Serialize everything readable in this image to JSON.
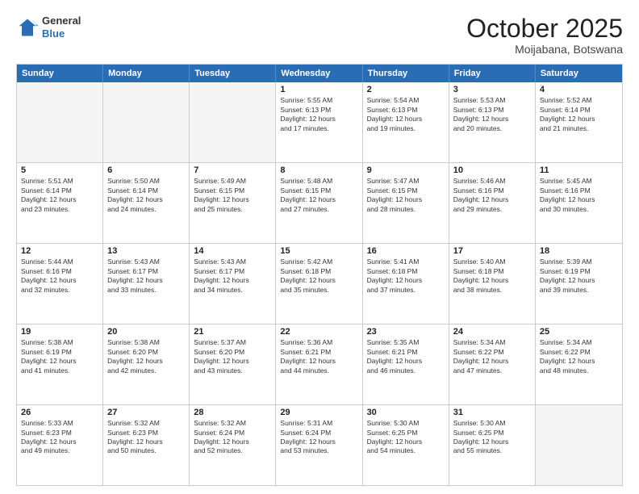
{
  "header": {
    "logo_general": "General",
    "logo_blue": "Blue",
    "month_title": "October 2025",
    "location": "Moijabana, Botswana"
  },
  "weekdays": [
    "Sunday",
    "Monday",
    "Tuesday",
    "Wednesday",
    "Thursday",
    "Friday",
    "Saturday"
  ],
  "rows": [
    [
      {
        "day": "",
        "info": ""
      },
      {
        "day": "",
        "info": ""
      },
      {
        "day": "",
        "info": ""
      },
      {
        "day": "1",
        "info": "Sunrise: 5:55 AM\nSunset: 6:13 PM\nDaylight: 12 hours\nand 17 minutes."
      },
      {
        "day": "2",
        "info": "Sunrise: 5:54 AM\nSunset: 6:13 PM\nDaylight: 12 hours\nand 19 minutes."
      },
      {
        "day": "3",
        "info": "Sunrise: 5:53 AM\nSunset: 6:13 PM\nDaylight: 12 hours\nand 20 minutes."
      },
      {
        "day": "4",
        "info": "Sunrise: 5:52 AM\nSunset: 6:14 PM\nDaylight: 12 hours\nand 21 minutes."
      }
    ],
    [
      {
        "day": "5",
        "info": "Sunrise: 5:51 AM\nSunset: 6:14 PM\nDaylight: 12 hours\nand 23 minutes."
      },
      {
        "day": "6",
        "info": "Sunrise: 5:50 AM\nSunset: 6:14 PM\nDaylight: 12 hours\nand 24 minutes."
      },
      {
        "day": "7",
        "info": "Sunrise: 5:49 AM\nSunset: 6:15 PM\nDaylight: 12 hours\nand 25 minutes."
      },
      {
        "day": "8",
        "info": "Sunrise: 5:48 AM\nSunset: 6:15 PM\nDaylight: 12 hours\nand 27 minutes."
      },
      {
        "day": "9",
        "info": "Sunrise: 5:47 AM\nSunset: 6:15 PM\nDaylight: 12 hours\nand 28 minutes."
      },
      {
        "day": "10",
        "info": "Sunrise: 5:46 AM\nSunset: 6:16 PM\nDaylight: 12 hours\nand 29 minutes."
      },
      {
        "day": "11",
        "info": "Sunrise: 5:45 AM\nSunset: 6:16 PM\nDaylight: 12 hours\nand 30 minutes."
      }
    ],
    [
      {
        "day": "12",
        "info": "Sunrise: 5:44 AM\nSunset: 6:16 PM\nDaylight: 12 hours\nand 32 minutes."
      },
      {
        "day": "13",
        "info": "Sunrise: 5:43 AM\nSunset: 6:17 PM\nDaylight: 12 hours\nand 33 minutes."
      },
      {
        "day": "14",
        "info": "Sunrise: 5:43 AM\nSunset: 6:17 PM\nDaylight: 12 hours\nand 34 minutes."
      },
      {
        "day": "15",
        "info": "Sunrise: 5:42 AM\nSunset: 6:18 PM\nDaylight: 12 hours\nand 35 minutes."
      },
      {
        "day": "16",
        "info": "Sunrise: 5:41 AM\nSunset: 6:18 PM\nDaylight: 12 hours\nand 37 minutes."
      },
      {
        "day": "17",
        "info": "Sunrise: 5:40 AM\nSunset: 6:18 PM\nDaylight: 12 hours\nand 38 minutes."
      },
      {
        "day": "18",
        "info": "Sunrise: 5:39 AM\nSunset: 6:19 PM\nDaylight: 12 hours\nand 39 minutes."
      }
    ],
    [
      {
        "day": "19",
        "info": "Sunrise: 5:38 AM\nSunset: 6:19 PM\nDaylight: 12 hours\nand 41 minutes."
      },
      {
        "day": "20",
        "info": "Sunrise: 5:38 AM\nSunset: 6:20 PM\nDaylight: 12 hours\nand 42 minutes."
      },
      {
        "day": "21",
        "info": "Sunrise: 5:37 AM\nSunset: 6:20 PM\nDaylight: 12 hours\nand 43 minutes."
      },
      {
        "day": "22",
        "info": "Sunrise: 5:36 AM\nSunset: 6:21 PM\nDaylight: 12 hours\nand 44 minutes."
      },
      {
        "day": "23",
        "info": "Sunrise: 5:35 AM\nSunset: 6:21 PM\nDaylight: 12 hours\nand 46 minutes."
      },
      {
        "day": "24",
        "info": "Sunrise: 5:34 AM\nSunset: 6:22 PM\nDaylight: 12 hours\nand 47 minutes."
      },
      {
        "day": "25",
        "info": "Sunrise: 5:34 AM\nSunset: 6:22 PM\nDaylight: 12 hours\nand 48 minutes."
      }
    ],
    [
      {
        "day": "26",
        "info": "Sunrise: 5:33 AM\nSunset: 6:23 PM\nDaylight: 12 hours\nand 49 minutes."
      },
      {
        "day": "27",
        "info": "Sunrise: 5:32 AM\nSunset: 6:23 PM\nDaylight: 12 hours\nand 50 minutes."
      },
      {
        "day": "28",
        "info": "Sunrise: 5:32 AM\nSunset: 6:24 PM\nDaylight: 12 hours\nand 52 minutes."
      },
      {
        "day": "29",
        "info": "Sunrise: 5:31 AM\nSunset: 6:24 PM\nDaylight: 12 hours\nand 53 minutes."
      },
      {
        "day": "30",
        "info": "Sunrise: 5:30 AM\nSunset: 6:25 PM\nDaylight: 12 hours\nand 54 minutes."
      },
      {
        "day": "31",
        "info": "Sunrise: 5:30 AM\nSunset: 6:25 PM\nDaylight: 12 hours\nand 55 minutes."
      },
      {
        "day": "",
        "info": ""
      }
    ]
  ]
}
